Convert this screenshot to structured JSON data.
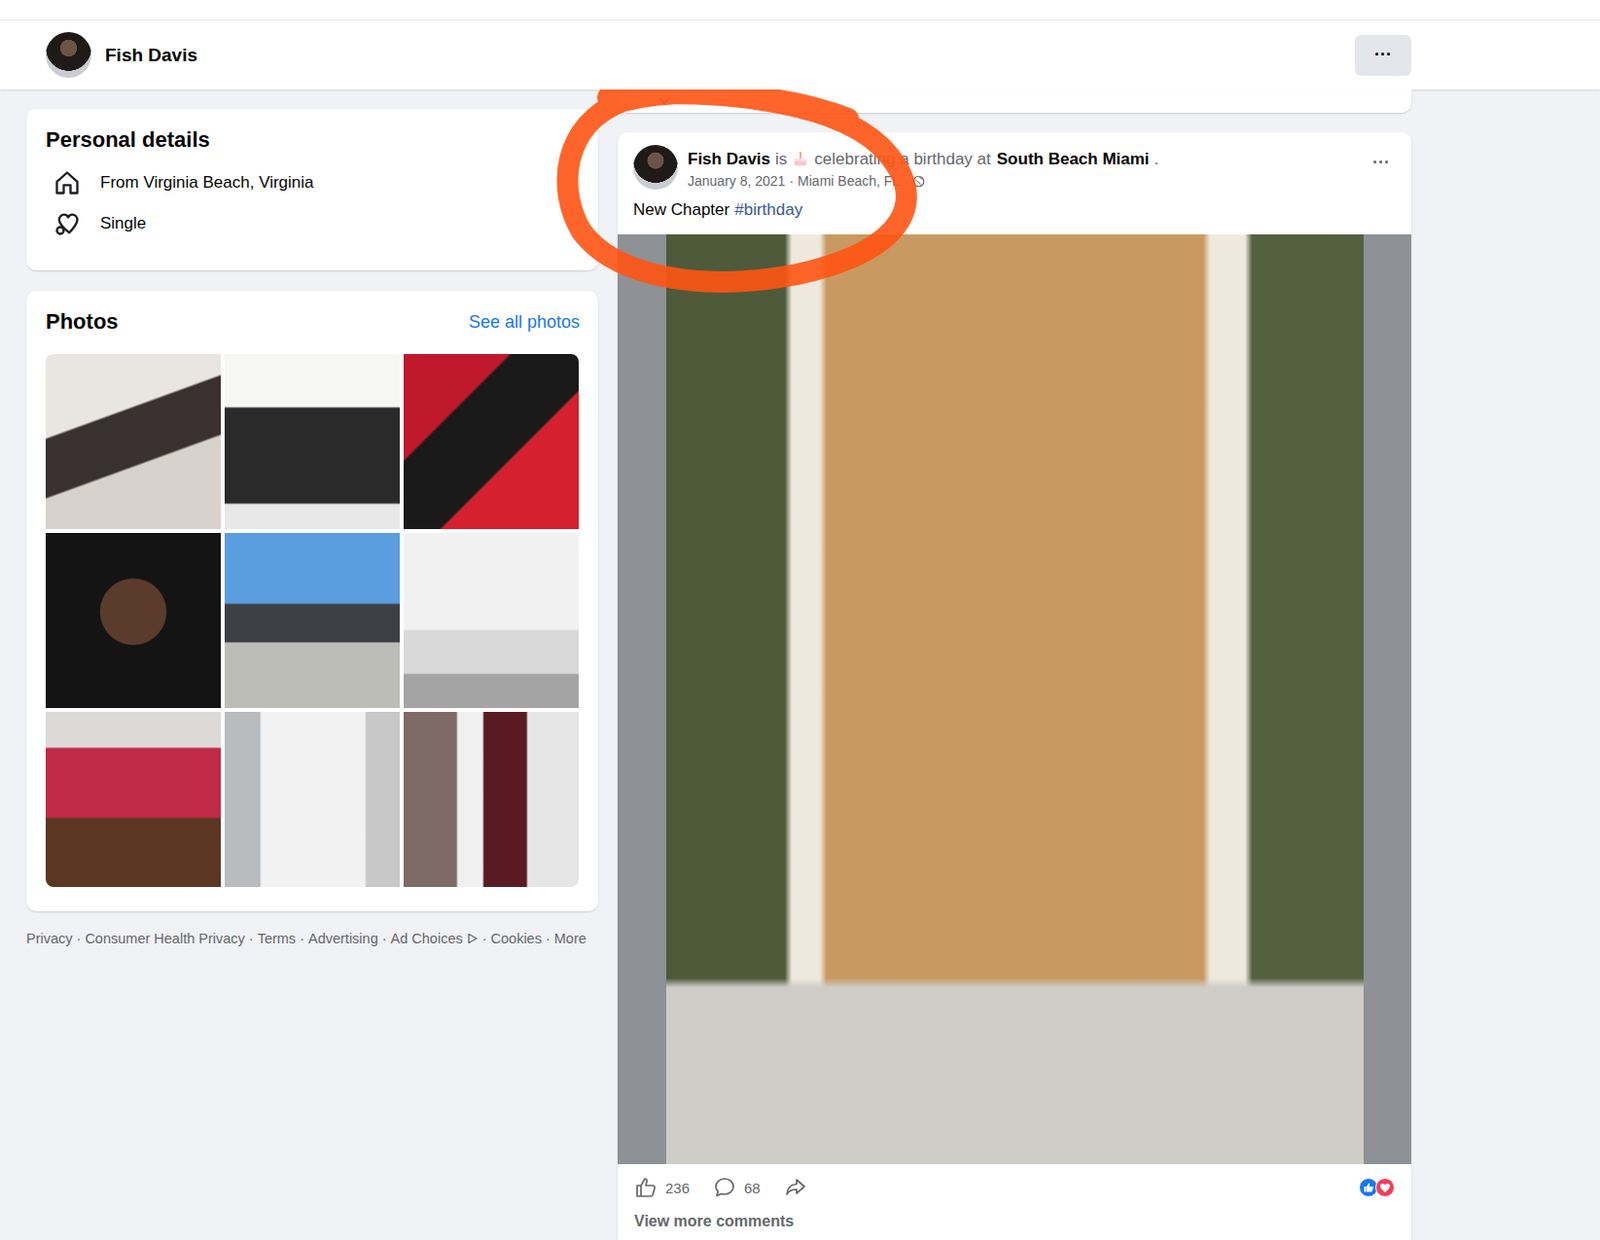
{
  "profile_bar": {
    "name": "Fish Davis",
    "menu": "···"
  },
  "personal_details": {
    "title": "Personal details",
    "items": [
      {
        "kind": "home",
        "text": "From Virginia Beach, Virginia"
      },
      {
        "kind": "relationship",
        "text": "Single"
      }
    ]
  },
  "photos": {
    "title": "Photos",
    "link": "See all photos"
  },
  "footer": {
    "separator": "·",
    "links": [
      {
        "kind": "text",
        "text": "Privacy"
      },
      {
        "kind": "text",
        "text": "Consumer Health Privacy"
      },
      {
        "kind": "text",
        "text": "Terms"
      },
      {
        "kind": "text",
        "text": "Advertising"
      },
      {
        "kind": "adchoices",
        "text": "Ad Choices"
      },
      {
        "kind": "text",
        "text": "Cookies"
      },
      {
        "kind": "text",
        "text": "More"
      }
    ]
  },
  "post": {
    "author": "Fish Davis",
    "verb": "is",
    "activity": "celebrating a birthday at",
    "place": "South Beach Miami",
    "end": ".",
    "date": "January 8, 2021",
    "separator": "·",
    "location": "Miami Beach, FL",
    "text": "New Chapter",
    "hashtag": "#birthday",
    "menu": "···",
    "likes": "236",
    "comments": "68",
    "view_more": "View more comments"
  }
}
